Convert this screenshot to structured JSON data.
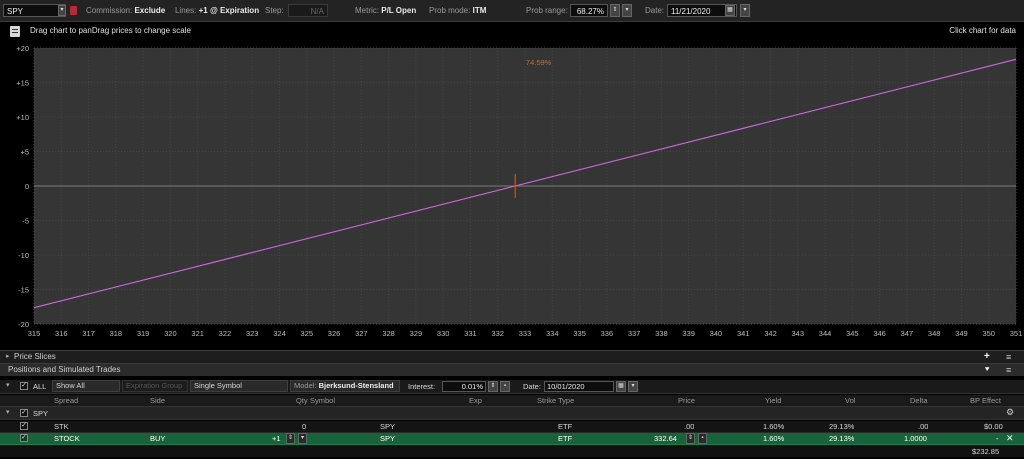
{
  "toolbar": {
    "symbol": "SPY",
    "commission_label": "Commission:",
    "commission_value": "Exclude",
    "lines_label": "Lines:",
    "lines_value": "+1 @ Expiration",
    "step_label": "Step:",
    "step_value": "N/A",
    "metric_label": "Metric:",
    "metric_value": "P/L Open",
    "prob_mode_label": "Prob mode:",
    "prob_mode_value": "ITM",
    "prob_range_label": "Prob range:",
    "prob_range_value": "68.27%",
    "date_label": "Date:",
    "date_value": "11/21/2020"
  },
  "chart_header": {
    "hint": "Drag chart to panDrag prices to change scale",
    "click_hint": "Click chart for data"
  },
  "chart_data": {
    "type": "line",
    "x_ticks": [
      "315",
      "316",
      "317",
      "318",
      "319",
      "320",
      "321",
      "322",
      "323",
      "324",
      "325",
      "326",
      "327",
      "328",
      "329",
      "330",
      "331",
      "332",
      "333",
      "334",
      "335",
      "336",
      "337",
      "338",
      "339",
      "340",
      "341",
      "342",
      "343",
      "344",
      "345",
      "346",
      "347",
      "348",
      "349",
      "350",
      "351"
    ],
    "y_ticks": [
      "+20",
      "+15",
      "+10",
      "+5",
      "0",
      "-5",
      "-10",
      "-15",
      "-20"
    ],
    "xlim": [
      315,
      351
    ],
    "ylim": [
      -20,
      20
    ],
    "series": [
      {
        "values": [
          [
            315,
            -17.64
          ],
          [
            351,
            18.36
          ]
        ],
        "color": "#c86ad8"
      }
    ],
    "zero_line_color": "#7a7a7a",
    "current_price_marker": {
      "x": 332.64,
      "color": "#d2642a"
    },
    "annotation": {
      "text": "74.59%",
      "x": 333.5,
      "y": 18,
      "color": "#b8743a"
    }
  },
  "price_slices": {
    "label": "Price Slices",
    "add_icon": "plus-icon",
    "menu_icon": "hamburger-icon"
  },
  "positions": {
    "title": "Positions and Simulated Trades",
    "filter_all": "ALL",
    "show_all": "Show All",
    "expiration_group": "Expiration Group",
    "single_symbol": "Single Symbol",
    "model_label": "Model:",
    "model_value": "Bjerksund-Stensland",
    "interest_label": "Interest:",
    "interest_value": "0.01%",
    "date_label": "Date:",
    "date_value": "10/01/2020",
    "columns": [
      "Spread",
      "Side",
      "Qty",
      "Symbol",
      "Exp",
      "Strike",
      "Type",
      "Price",
      "Yield",
      "Vol",
      "Delta",
      "BP Effect"
    ],
    "group": "SPY",
    "rows": [
      {
        "spread": "STK",
        "side": "",
        "qty": "0",
        "symbol": "SPY",
        "exp": "",
        "strike": "",
        "type": "ETF",
        "price": ".00",
        "yield": "1.60%",
        "vol": "29.13%",
        "delta": ".00",
        "bp": "$0.00"
      },
      {
        "spread": "STOCK",
        "side": "BUY",
        "qty": "+1",
        "symbol": "SPY",
        "exp": "",
        "strike": "",
        "type": "ETF",
        "price": "332.64",
        "yield": "1.60%",
        "vol": "29.13%",
        "delta": "1.0000",
        "bp": "-"
      }
    ],
    "total_bp": "$232.85"
  }
}
